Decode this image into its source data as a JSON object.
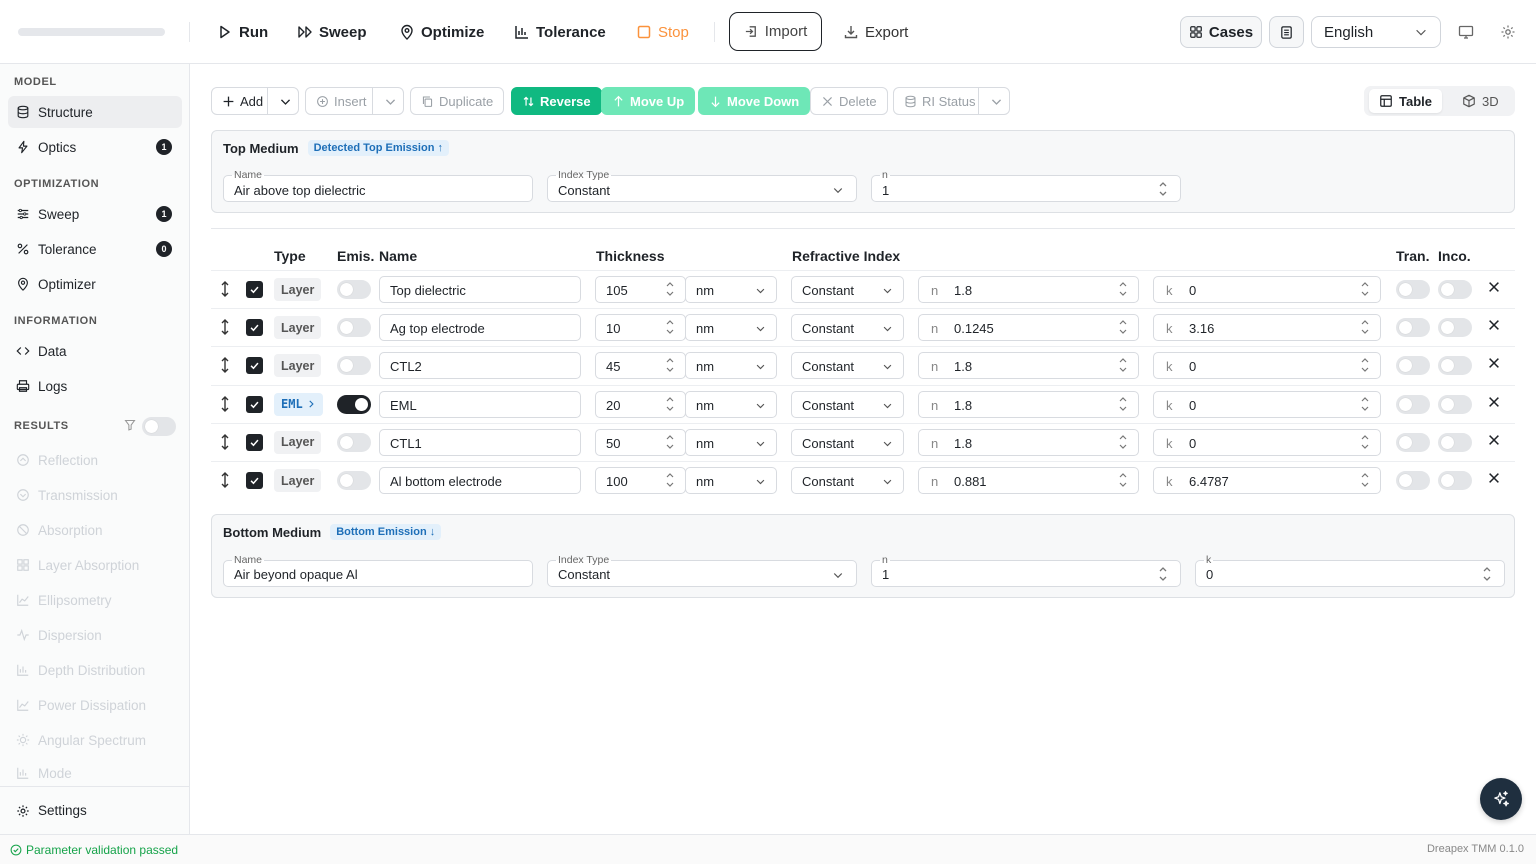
{
  "toolbar": {
    "run": "Run",
    "sweep": "Sweep",
    "optimize": "Optimize",
    "tolerance": "Tolerance",
    "stop": "Stop",
    "import": "Import",
    "export": "Export",
    "cases": "Cases",
    "language": "English"
  },
  "sidebar": {
    "model_title": "MODEL",
    "structure": "Structure",
    "optics": "Optics",
    "optics_count": "1",
    "optimization_title": "OPTIMIZATION",
    "sweep": "Sweep",
    "sweep_count": "1",
    "tolerance": "Tolerance",
    "tolerance_count": "0",
    "optimizer": "Optimizer",
    "information_title": "INFORMATION",
    "data": "Data",
    "logs": "Logs",
    "results_title": "RESULTS",
    "results": [
      "Reflection",
      "Transmission",
      "Absorption",
      "Layer Absorption",
      "Ellipsometry",
      "Dispersion",
      "Depth Distribution",
      "Power Dissipation",
      "Angular Spectrum",
      "Mode"
    ],
    "settings": "Settings"
  },
  "actions": {
    "add": "Add",
    "insert": "Insert",
    "duplicate": "Duplicate",
    "reverse": "Reverse",
    "move_up": "Move Up",
    "move_down": "Move Down",
    "delete": "Delete",
    "ri_status": "RI Status",
    "table": "Table",
    "view3d": "3D"
  },
  "top_medium": {
    "title": "Top Medium",
    "tag": "Detected Top Emission ↑",
    "name_label": "Name",
    "name": "Air above top dielectric",
    "index_type_label": "Index Type",
    "index_type": "Constant",
    "n_label": "n",
    "n": "1"
  },
  "table_headers": {
    "type": "Type",
    "emis": "Emis.",
    "name": "Name",
    "thickness": "Thickness",
    "ri": "Refractive Index",
    "tran": "Tran.",
    "inco": "Inco."
  },
  "n_prefix": "n",
  "k_prefix": "k",
  "layers": [
    {
      "type": "Layer",
      "emissive": false,
      "name": "Top dielectric",
      "thickness": "105",
      "unit": "nm",
      "ri_type": "Constant",
      "n": "1.8",
      "k": "0"
    },
    {
      "type": "Layer",
      "emissive": false,
      "name": "Ag top electrode",
      "thickness": "10",
      "unit": "nm",
      "ri_type": "Constant",
      "n": "0.1245",
      "k": "3.16"
    },
    {
      "type": "Layer",
      "emissive": false,
      "name": "CTL2",
      "thickness": "45",
      "unit": "nm",
      "ri_type": "Constant",
      "n": "1.8",
      "k": "0"
    },
    {
      "type": "EML",
      "emissive": true,
      "name": "EML",
      "thickness": "20",
      "unit": "nm",
      "ri_type": "Constant",
      "n": "1.8",
      "k": "0"
    },
    {
      "type": "Layer",
      "emissive": false,
      "name": "CTL1",
      "thickness": "50",
      "unit": "nm",
      "ri_type": "Constant",
      "n": "1.8",
      "k": "0"
    },
    {
      "type": "Layer",
      "emissive": false,
      "name": "Al bottom electrode",
      "thickness": "100",
      "unit": "nm",
      "ri_type": "Constant",
      "n": "0.881",
      "k": "6.4787"
    }
  ],
  "bottom_medium": {
    "title": "Bottom Medium",
    "tag": "Bottom Emission ↓",
    "name_label": "Name",
    "name": "Air beyond opaque Al",
    "index_type_label": "Index Type",
    "index_type": "Constant",
    "n_label": "n",
    "n": "1",
    "k_label": "k",
    "k": "0"
  },
  "status": {
    "message": "Parameter validation passed",
    "version": "Dreapex TMM 0.1.0"
  },
  "colors": {
    "accent": "#10b981",
    "stop": "#fb923c",
    "tag": "#1e6fb8"
  }
}
